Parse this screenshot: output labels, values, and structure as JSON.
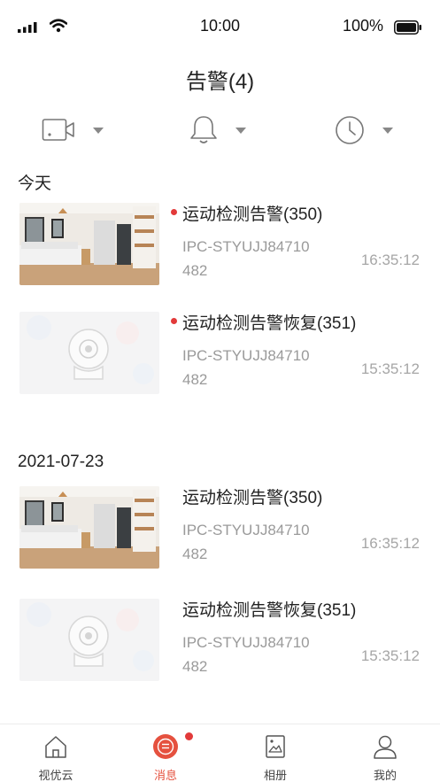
{
  "status_bar": {
    "time": "10:00",
    "battery": "100%"
  },
  "header": {
    "title": "告警(4)"
  },
  "filters": [
    {
      "name": "camera-filter",
      "icon": "camera-icon"
    },
    {
      "name": "alarm-type-filter",
      "icon": "bell-icon"
    },
    {
      "name": "time-filter",
      "icon": "clock-icon"
    }
  ],
  "sections": [
    {
      "date": "今天",
      "items": [
        {
          "title": "运动检测告警(350)",
          "device_line1": "IPC-STYUJJ84710",
          "device_line2": "482",
          "time": "16:35:12",
          "unread": true,
          "thumb": "room-photo"
        },
        {
          "title": "运动检测告警恢复(351)",
          "device_line1": "IPC-STYUJJ84710",
          "device_line2": "482",
          "time": "15:35:12",
          "unread": true,
          "thumb": "camera-placeholder"
        }
      ]
    },
    {
      "date": "2021-07-23",
      "items": [
        {
          "title": "运动检测告警(350)",
          "device_line1": "IPC-STYUJJ84710",
          "device_line2": "482",
          "time": "16:35:12",
          "unread": false,
          "thumb": "room-photo"
        },
        {
          "title": "运动检测告警恢复(351)",
          "device_line1": "IPC-STYUJJ84710",
          "device_line2": "482",
          "time": "15:35:12",
          "unread": false,
          "thumb": "camera-placeholder"
        }
      ]
    }
  ],
  "tabs": [
    {
      "label": "视优云",
      "icon": "home-icon",
      "active": false
    },
    {
      "label": "消息",
      "icon": "message-icon",
      "active": true,
      "badge": true
    },
    {
      "label": "相册",
      "icon": "album-icon",
      "active": false
    },
    {
      "label": "我的",
      "icon": "user-icon",
      "active": false
    }
  ],
  "colors": {
    "accent": "#e5513f",
    "unread_dot": "#e23a3a",
    "secondary_text": "#9a9a9a"
  }
}
